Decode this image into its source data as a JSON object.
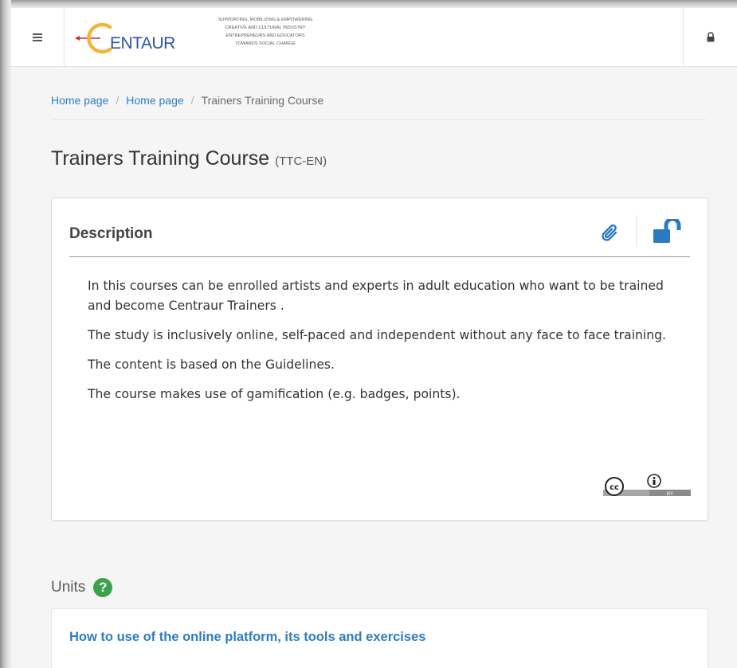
{
  "header": {
    "logo_text": "ENTAUR",
    "tagline": [
      "Supporting, mobilizing & empowering",
      "creative and cultural industry",
      "entrepreneurs and educators",
      "towards social change"
    ],
    "menu_icon": "hamburger-menu-icon",
    "lock_icon": "lock-icon"
  },
  "breadcrumb": {
    "items": [
      "Home page",
      "Home page",
      "Trainers Training Course"
    ],
    "separator": "/"
  },
  "page": {
    "title": "Trainers Training Course",
    "code": "(TTC-EN)"
  },
  "description": {
    "title": "Description",
    "paragraphs": [
      "In this courses can be enrolled artists and experts in adult education who want to be trained and become Centraur Trainers .",
      "The study is inclusively online, self-paced and independent without any face to face training.",
      "The content is based on the Guidelines.",
      "The course makes use of gamification (e.g. badges, points)."
    ],
    "icons": [
      "paperclip-icon",
      "unlock-icon"
    ],
    "license": {
      "label": "BY",
      "icon": "creative-commons-by-icon"
    }
  },
  "units": {
    "heading": "Units",
    "help_icon": "?",
    "items": [
      {
        "title": "How to use of the online platform, its tools and exercises"
      }
    ]
  },
  "colors": {
    "link": "#2f7dc1",
    "accent_blue": "#2a7ac0",
    "help_green": "#3aa34a",
    "logo_orange": "#f2b33a",
    "logo_red": "#c9302c",
    "logo_blue": "#2e55a2"
  }
}
